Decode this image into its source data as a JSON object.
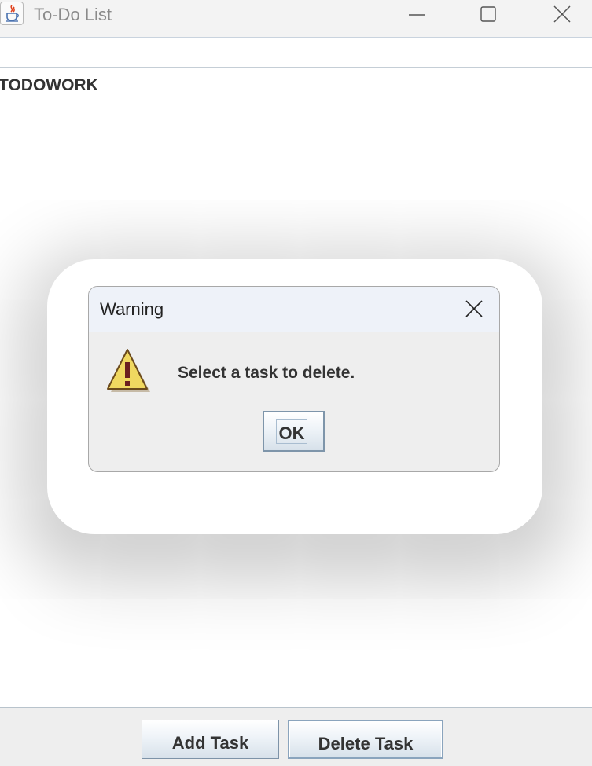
{
  "window": {
    "title": "To-Do List",
    "app_icon": "java-cup-icon"
  },
  "task_list": {
    "items": [
      "TODOWORK"
    ]
  },
  "bottom_panel": {
    "add_label": "Add Task",
    "delete_label": "Delete Task"
  },
  "dialog": {
    "title": "Warning",
    "message": "Select a task to delete.",
    "ok_label": "OK",
    "icon": "warning-icon"
  },
  "colors": {
    "warning_fill": "#f0d860",
    "warning_mark": "#6b1f1f"
  }
}
